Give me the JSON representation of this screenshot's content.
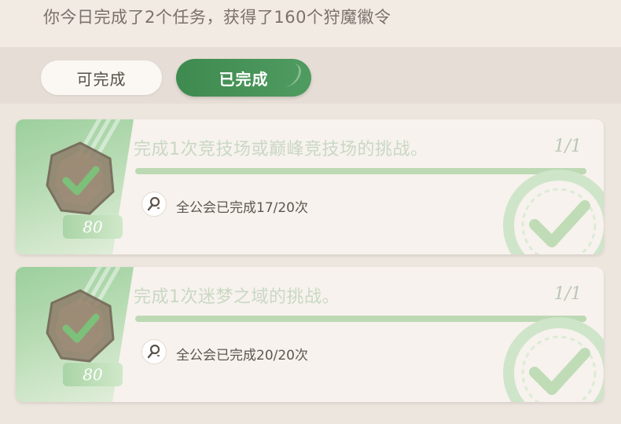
{
  "header": {
    "summary": "你今日完成了2个任务，获得了160个狩魔徽令"
  },
  "tabs": [
    {
      "label": "可完成",
      "active": false
    },
    {
      "label": "已完成",
      "active": true
    }
  ],
  "colors": {
    "accent_green": "#4a9459",
    "completed_title": "#c9d8c4",
    "background": "#e6ded6"
  },
  "tasks": [
    {
      "title": "完成1次竞技场或巅峰竞技场的挑战。",
      "progress": "1/1",
      "progress_fraction": 1.0,
      "reward": "80",
      "guild_status": "全公会已完成17/20次",
      "emblem_icon": "emblem-check-icon",
      "status_icon": "completed-stamp-icon"
    },
    {
      "title": "完成1次迷梦之域的挑战。",
      "progress": "1/1",
      "progress_fraction": 1.0,
      "reward": "80",
      "guild_status": "全公会已完成20/20次",
      "emblem_icon": "emblem-check-icon",
      "status_icon": "completed-stamp-icon"
    }
  ]
}
